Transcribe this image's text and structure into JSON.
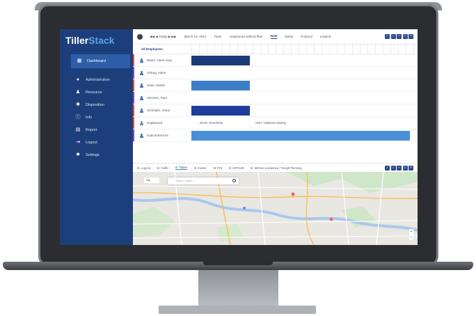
{
  "app": {
    "logo_a": "Tiller",
    "logo_b": "Stack"
  },
  "sidebar": {
    "items": [
      {
        "label": "Dashboard",
        "icon": "grid-icon"
      },
      {
        "label": "Administration",
        "icon": "user-icon"
      },
      {
        "label": "Resource",
        "icon": "users-icon"
      },
      {
        "label": "Disposition",
        "icon": "gear-icon"
      },
      {
        "label": "Info",
        "icon": "info-icon"
      },
      {
        "label": "Report",
        "icon": "chart-icon"
      },
      {
        "label": "Logout",
        "icon": "logout-icon"
      },
      {
        "label": "Settings",
        "icon": "settings-icon"
      }
    ]
  },
  "toolbar": {
    "nav": "◀◀ ◀ Today ▶ ▶▶",
    "date": "March 19, 2021",
    "items": [
      "Team",
      "Unplanned without filter",
      "Now",
      "Delay",
      "Protocol",
      "Legend"
    ],
    "active_index": 2
  },
  "scheduler": {
    "header": "All Employees",
    "rows": [
      {
        "name": "Bauer, Hans-Jorg",
        "color": "#4a6fb0"
      },
      {
        "name": "Gebug, Hans",
        "color": "#4a6fb0"
      },
      {
        "name": "Haas, Martin",
        "color": "#4a6fb0"
      },
      {
        "name": "Janssen, Paul",
        "color": "#4a6fb0"
      },
      {
        "name": "Schmaltz, Anton",
        "color": "#4a6fb0"
      },
      {
        "name": "Unplanned",
        "color": "#7a8494"
      },
      {
        "name": "Subcontractors",
        "color": "#4a6fb0"
      }
    ],
    "unplanned_cells": [
      "MAIN, Geneforter",
      "CDH / address missing"
    ]
  },
  "map": {
    "tabs": [
      "Legend",
      "Traffic",
      "Times",
      "Cluster",
      "POI",
      "ZIP/SUB",
      "Without unplanned / Rough Planning"
    ],
    "active_tab": 2,
    "search_placeholder": "Search location",
    "mini_label": "Map"
  },
  "colors": {
    "sidebar": "#1c3f7c",
    "bar_dark": "#1a3a7a",
    "bar_mid": "#3d7dc8",
    "bar_light": "#4b8fd6",
    "marker_red": "#e0523a",
    "marker_purple": "#7b4fb5"
  }
}
